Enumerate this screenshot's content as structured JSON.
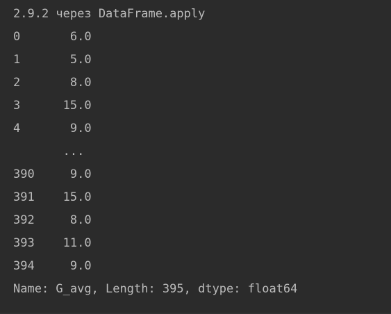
{
  "console": {
    "header": "2.9.2 через DataFrame.apply",
    "rows": [
      "0       6.0",
      "1       5.0",
      "2       8.0",
      "3      15.0",
      "4       9.0",
      "       ...",
      "390     9.0",
      "391    15.0",
      "392     8.0",
      "393    11.0",
      "394     9.0"
    ],
    "footer": "Name: G_avg, Length: 395, dtype: float64"
  }
}
